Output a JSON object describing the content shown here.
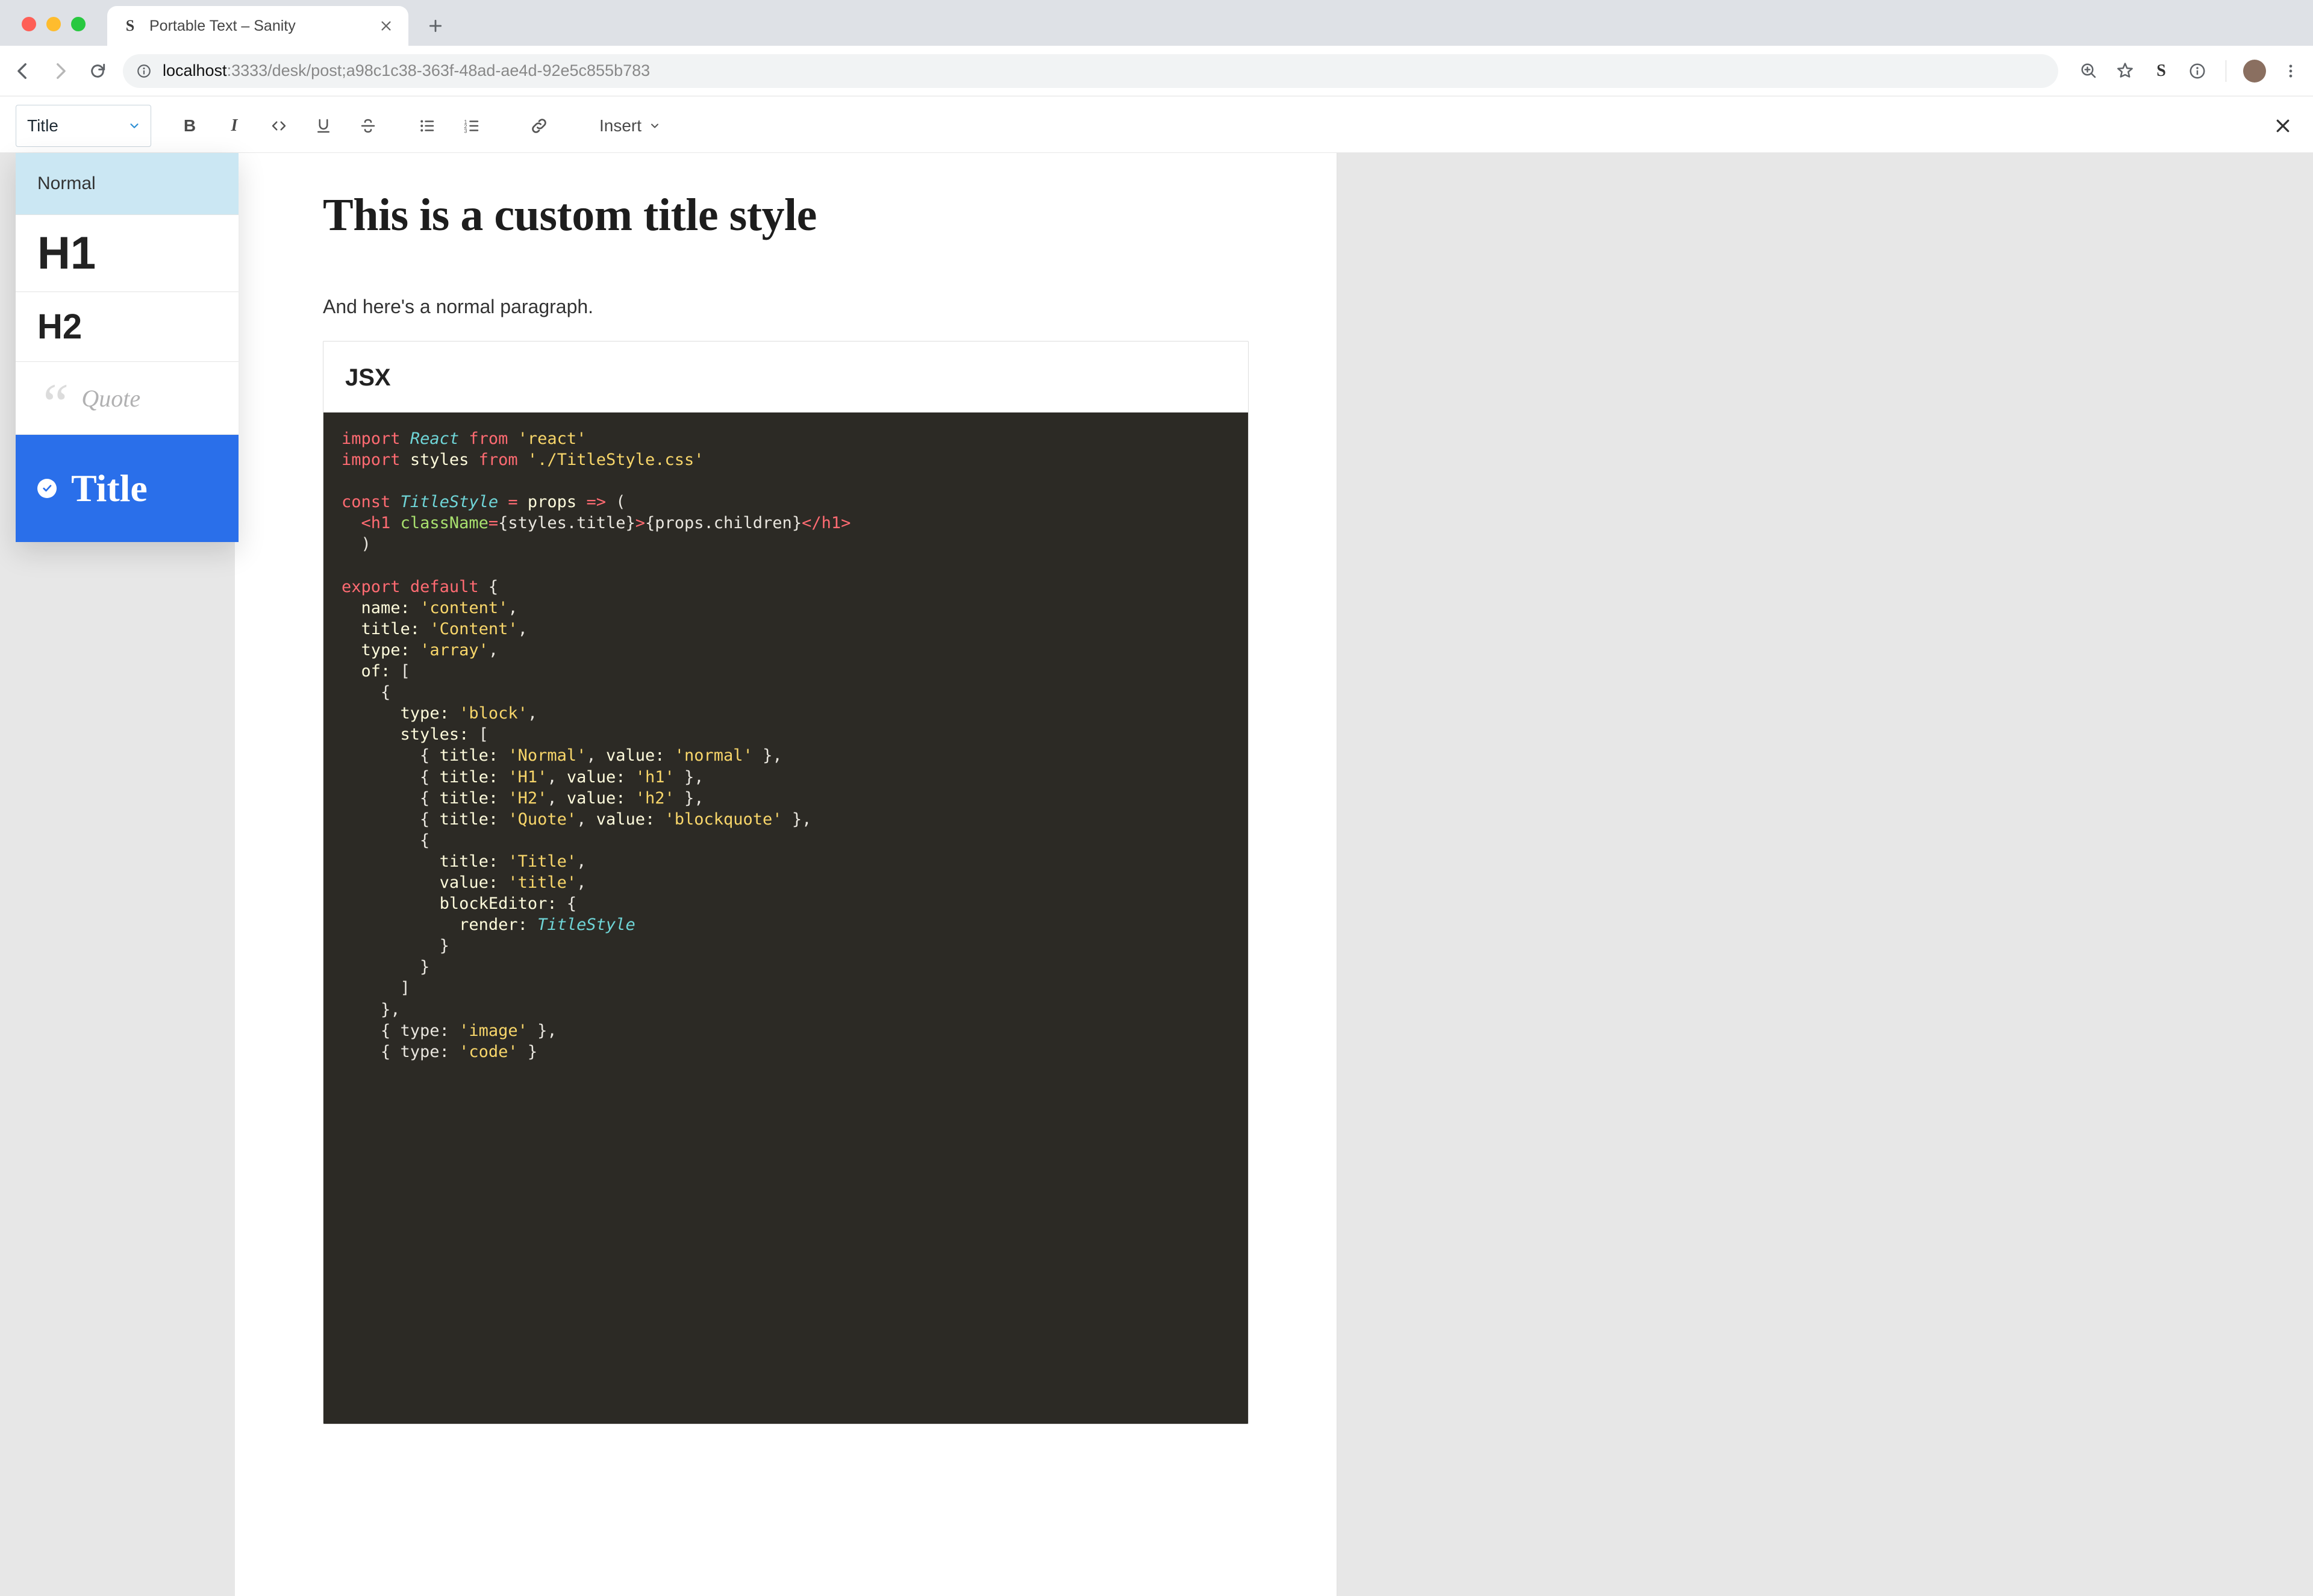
{
  "browser": {
    "tab_title": "Portable Text – Sanity",
    "url_prefix": "localhost",
    "url_path": ":3333/desk/post;a98c1c38-363f-48ad-ae4d-92e5c855b783"
  },
  "toolbar": {
    "style_label": "Title",
    "insert_label": "Insert",
    "buttons": {
      "bold": "B",
      "italic": "I",
      "code": "<>",
      "underline": "U",
      "strike": "S",
      "ul": "•",
      "ol": "1.",
      "link": "link"
    }
  },
  "dropdown": {
    "normal": "Normal",
    "h1": "H1",
    "h2": "H2",
    "quote": "Quote",
    "title": "Title"
  },
  "doc": {
    "title": "This is a custom title style",
    "paragraph": "And here's a normal paragraph.",
    "code_language": "JSX"
  },
  "code": {
    "react_import_kw1": "import",
    "react_import_name": "React",
    "react_import_kw2": "from",
    "react_import_str": "'react'",
    "styles_import_kw1": "import",
    "styles_import_name": "styles",
    "styles_import_kw2": "from",
    "styles_import_str": "'./TitleStyle.css'",
    "const_kw": "const",
    "const_name": "TitleStyle",
    "eq": "=",
    "props_name": "props",
    "arrow": "=>",
    "openp": "(",
    "h1_open": "<h1",
    "class_attr": "className",
    "eq2": "=",
    "styles_title": "{styles.title}",
    "gt": ">",
    "children": "{props.children}",
    "h1_close": "</h1>",
    "closep": ")",
    "export_kw": "export",
    "default_kw": "default",
    "brace_o": "{",
    "name_k": "name:",
    "name_v": "'content'",
    "title_k": "title:",
    "title_v": "'Content'",
    "type_k": "type:",
    "type_v": "'array'",
    "of_k": "of:",
    "brack_o": "[",
    "block_type_k": "type:",
    "block_type_v": "'block'",
    "styles_k": "styles:",
    "s_normal_t": "'Normal'",
    "s_normal_v": "'normal'",
    "s_h1_t": "'H1'",
    "s_h1_v": "'h1'",
    "s_h2_t": "'H2'",
    "s_h2_v": "'h2'",
    "s_quote_t": "'Quote'",
    "s_quote_v": "'blockquote'",
    "s_title_t": "'Title'",
    "s_title_v": "'title'",
    "render_k": "render:",
    "render_v": "TitleStyle",
    "img_line": "{ type: ",
    "img_v": "'image'",
    "img_end": " },",
    "code_line": "{ type: ",
    "code_v": "'code'",
    "code_end": " }",
    "title2_k": "title:",
    "value_k": "value:",
    "blockEditor_k": "blockEditor:"
  }
}
